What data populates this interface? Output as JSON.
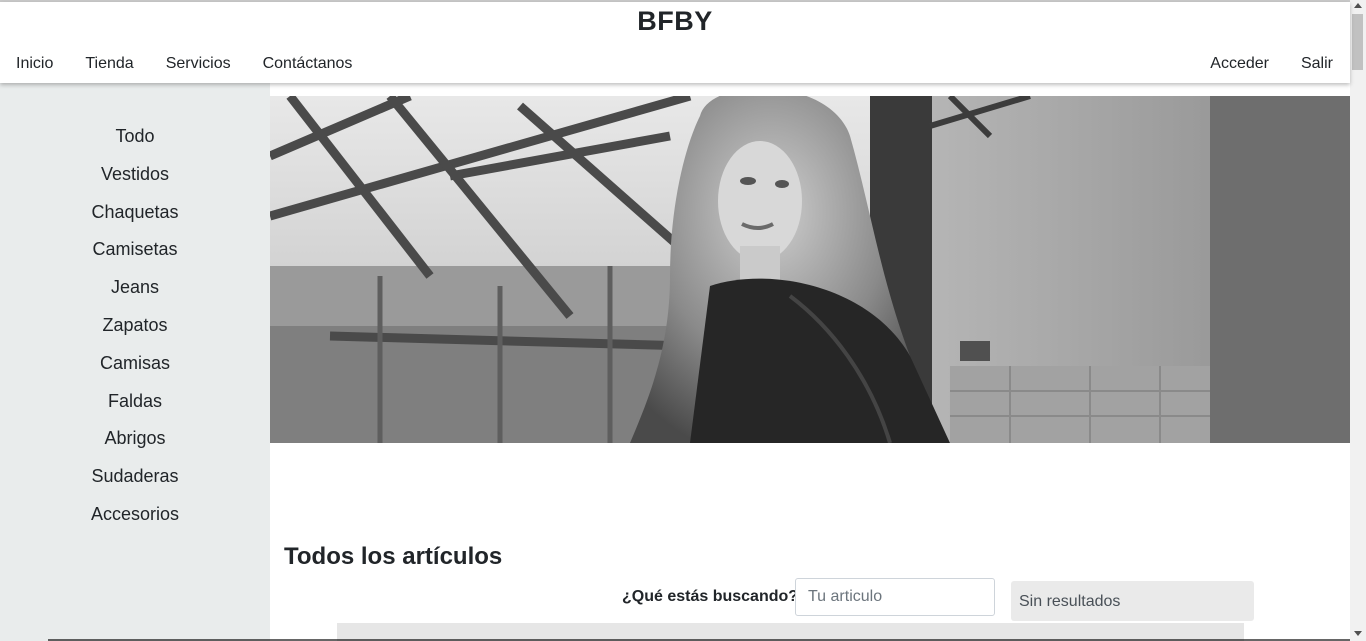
{
  "brand": "BFBY",
  "nav": {
    "left": [
      "Inicio",
      "Tienda",
      "Servicios",
      "Contáctanos"
    ],
    "right": [
      "Acceder",
      "Salir"
    ]
  },
  "sidebar": {
    "categories": [
      "Todo",
      "Vestidos",
      "Chaquetas",
      "Camisetas",
      "Jeans",
      "Zapatos",
      "Camisas",
      "Faldas",
      "Abrigos",
      "Sudaderas",
      "Accesorios"
    ]
  },
  "main": {
    "title": "Todos los artículos",
    "search": {
      "label": "¿Qué estás buscando?",
      "placeholder": "Tu articulo",
      "value": ""
    },
    "results": "Sin resultados"
  }
}
